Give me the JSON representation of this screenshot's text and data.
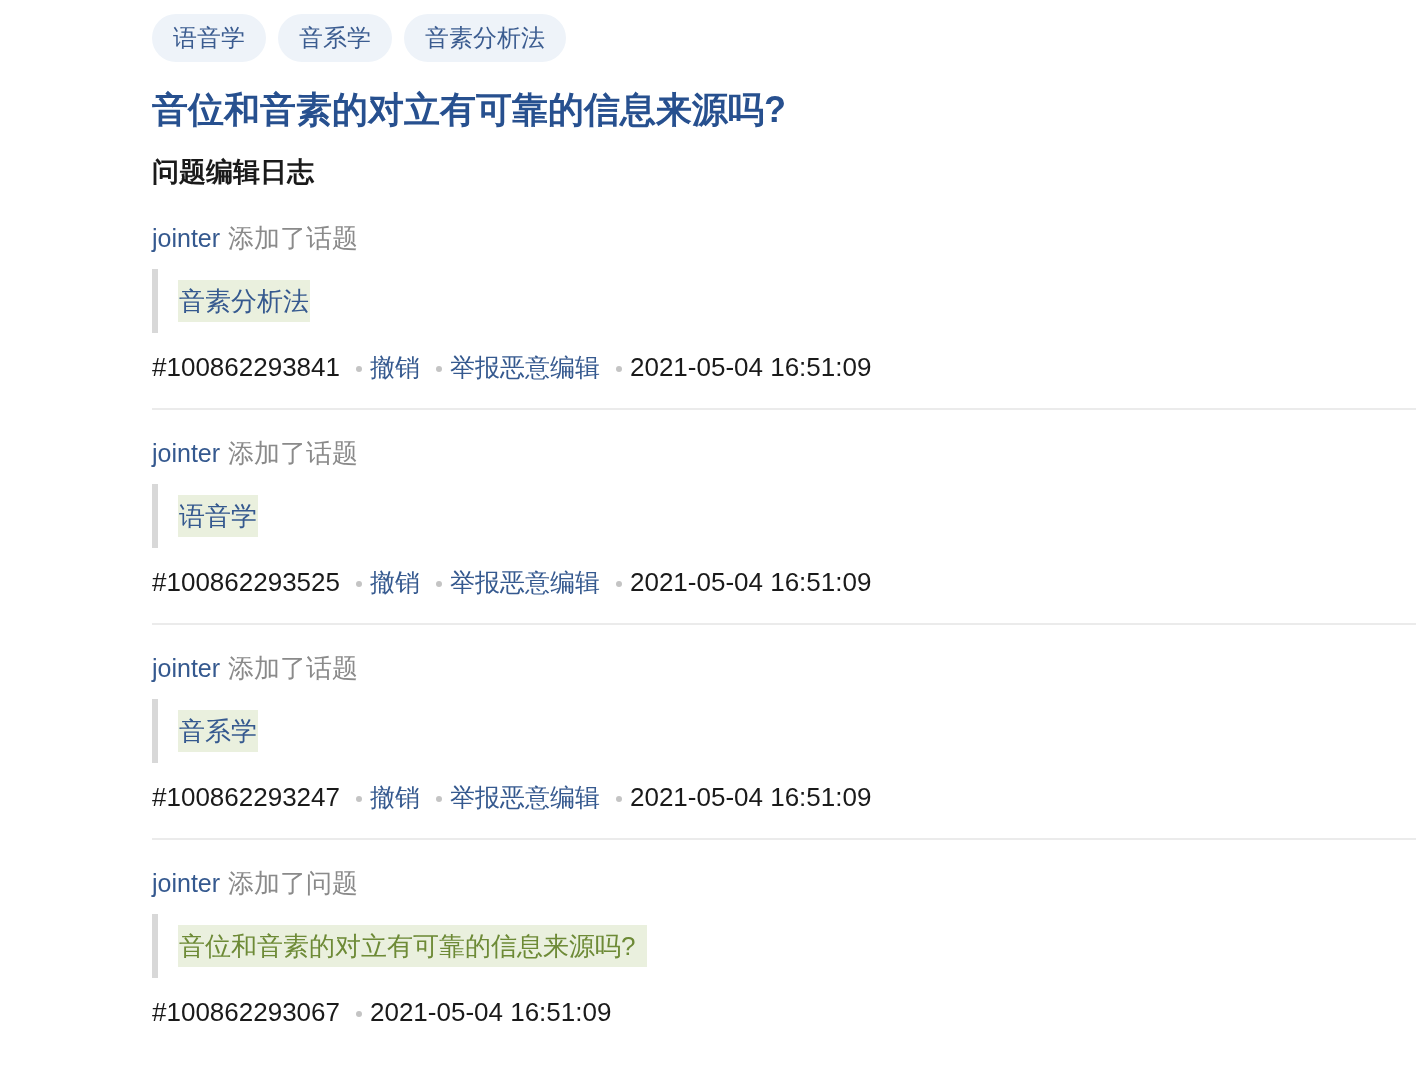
{
  "tags": [
    {
      "label": "语音学"
    },
    {
      "label": "音系学"
    },
    {
      "label": "音素分析法"
    }
  ],
  "title": "音位和音素的对立有可靠的信息来源吗?",
  "section_title": "问题编辑日志",
  "log": [
    {
      "user": "jointer",
      "action": "添加了话题",
      "kind": "topic",
      "content": "音素分析法",
      "id": "#100862293841",
      "links": [
        "撤销",
        "举报恶意编辑"
      ],
      "time": "2021-05-04 16:51:09"
    },
    {
      "user": "jointer",
      "action": "添加了话题",
      "kind": "topic",
      "content": "语音学",
      "id": "#100862293525",
      "links": [
        "撤销",
        "举报恶意编辑"
      ],
      "time": "2021-05-04 16:51:09"
    },
    {
      "user": "jointer",
      "action": "添加了话题",
      "kind": "topic",
      "content": "音系学",
      "id": "#100862293247",
      "links": [
        "撤销",
        "举报恶意编辑"
      ],
      "time": "2021-05-04 16:51:09"
    },
    {
      "user": "jointer",
      "action": "添加了问题",
      "kind": "question",
      "content": "音位和音素的对立有可靠的信息来源吗?",
      "id": "#100862293067",
      "time": "2021-05-04 16:51:09"
    }
  ]
}
